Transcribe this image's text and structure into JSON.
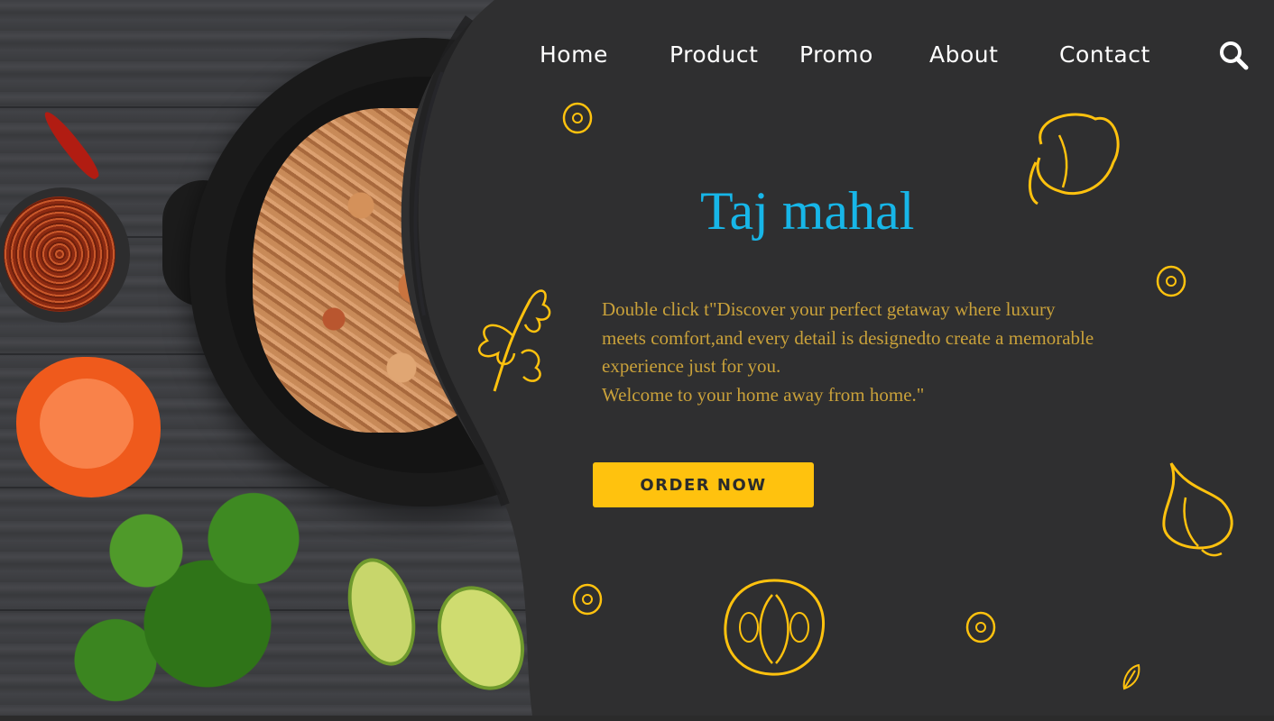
{
  "nav": {
    "items": [
      {
        "label": "Home"
      },
      {
        "label": "Product"
      },
      {
        "label": "Promo"
      },
      {
        "label": "About"
      },
      {
        "label": "Contact"
      }
    ],
    "search_icon": "search-icon"
  },
  "hero": {
    "title": "Taj mahal",
    "description_lines": [
      "Double click t\"Discover your perfect getaway where luxury",
      "meets comfort,and every detail is designedto create a memorable",
      "experience just for you.",
      "Welcome to your home away from home.\""
    ],
    "cta_label": "ORDER NOW"
  },
  "colors": {
    "panel": "#2f2f30",
    "title": "#17b6e8",
    "description": "#c9a13a",
    "accent": "#ffc20e",
    "nav_text": "#ffffff"
  },
  "decorations": [
    "bell-pepper-doodle-icon",
    "parsley-doodle-icon",
    "garlic-doodle-icon",
    "tomato-doodle-icon",
    "seed-doodle-icon",
    "leaf-doodle-icon"
  ]
}
